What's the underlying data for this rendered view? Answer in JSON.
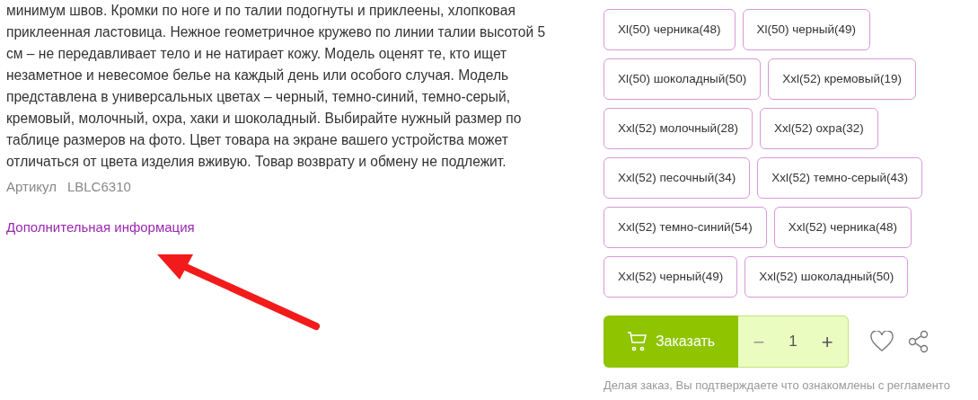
{
  "description": {
    "text": "минимум швов. Кромки по ноге и по талии подогнуты и приклеены, хлопковая приклеенная ластовица. Нежное геометричное кружево по линии талии высотой 5 см – не передавливает тело и не натирает кожу. Модель оценят те, кто ищет незаметное и невесомое белье на каждый день или особого случая. Модель представлена в универсальных цветах – черный, темно-синий, темно-серый, кремовый, молочный, охра, хаки и шоколадный. Выбирайте нужный размер по таблице размеров на фото. Цвет товара на экране вашего устройства может отличаться от цвета изделия вживую. Товар возврату и обмену не подлежит.",
    "article_label": "Артикул",
    "article_value": "LBLC6310",
    "more_info_link": "Дополнительная информация"
  },
  "variants": [
    {
      "label": "Xl(50) черника(48)",
      "selected": false
    },
    {
      "label": "Xl(50) черный(49)",
      "selected": false
    },
    {
      "label": "Xl(50) шоколадный(50)",
      "selected": false
    },
    {
      "label": "Xxl(52) кремовый(19)",
      "selected": false
    },
    {
      "label": "Xxl(52) молочный(28)",
      "selected": false
    },
    {
      "label": "Xxl(52) охра(32)",
      "selected": false
    },
    {
      "label": "Xxl(52) песочный(34)",
      "selected": false
    },
    {
      "label": "Xxl(52) темно-серый(43)",
      "selected": false
    },
    {
      "label": "Xxl(52) темно-синий(54)",
      "selected": false
    },
    {
      "label": "Xxl(52) черника(48)",
      "selected": false
    },
    {
      "label": "Xxl(52) черный(49)",
      "selected": false
    },
    {
      "label": "Xxl(52) шоколадный(50)",
      "selected": false
    }
  ],
  "order": {
    "button": "Заказать",
    "minus": "−",
    "quantity": "1",
    "plus": "+"
  },
  "disclaimer": "Делая заказ, Вы подтверждаете что ознакомлены с регламенто"
}
